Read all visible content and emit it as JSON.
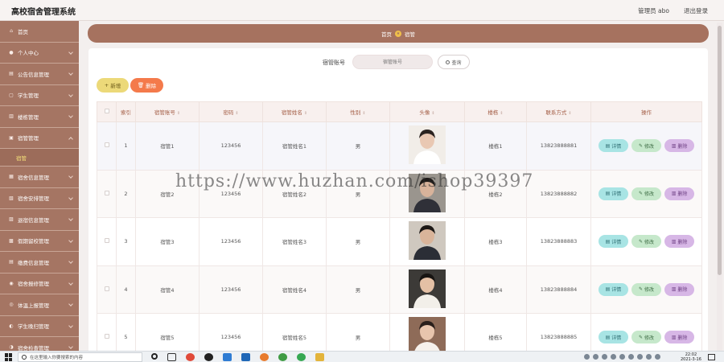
{
  "app": {
    "title": "高校宿舍管理系统",
    "user": "管理员 abo",
    "logout": "退出登录"
  },
  "sidebar": {
    "items": [
      {
        "label": "首页",
        "icon": "home-icon"
      },
      {
        "label": "个人中心",
        "icon": "user-icon"
      },
      {
        "label": "公告信息管理",
        "icon": "notice-icon"
      },
      {
        "label": "学生管理",
        "icon": "student-icon"
      },
      {
        "label": "楼栋管理",
        "icon": "building-icon"
      },
      {
        "label": "宿管管理",
        "icon": "manager-icon"
      }
    ],
    "active_sub": "宿管",
    "items_after": [
      {
        "label": "宿舍信息管理",
        "icon": "dorm-icon"
      },
      {
        "label": "宿舍安排管理",
        "icon": "arrange-icon"
      },
      {
        "label": "退宿信息管理",
        "icon": "checkout-icon"
      },
      {
        "label": "假期留校管理",
        "icon": "holiday-icon"
      },
      {
        "label": "缴费信息管理",
        "icon": "payment-icon"
      },
      {
        "label": "宿舍报修管理",
        "icon": "repair-icon"
      },
      {
        "label": "体温上报管理",
        "icon": "thermometer-icon"
      },
      {
        "label": "学生晚归管理",
        "icon": "late-icon"
      },
      {
        "label": "宿舍检查管理",
        "icon": "check-icon"
      }
    ]
  },
  "breadcrumb": {
    "home": "首页",
    "current": "宿管"
  },
  "search": {
    "label": "宿管账号",
    "placeholder": "宿管账号",
    "button": "查询"
  },
  "toolbar": {
    "add": "新增",
    "delete": "删除"
  },
  "table": {
    "headers": {
      "index": "索引",
      "account": "宿管账号",
      "password": "密码",
      "name": "宿管姓名",
      "gender": "性别",
      "avatar": "头像",
      "building": "楼栋",
      "phone": "联系方式",
      "actions": "操作"
    },
    "rows": [
      {
        "index": "1",
        "account": "宿管1",
        "password": "123456",
        "name": "宿管姓名1",
        "gender": "男",
        "building": "楼栋1",
        "phone": "13823888881"
      },
      {
        "index": "2",
        "account": "宿管2",
        "password": "123456",
        "name": "宿管姓名2",
        "gender": "男",
        "building": "楼栋2",
        "phone": "13823888882"
      },
      {
        "index": "3",
        "account": "宿管3",
        "password": "123456",
        "name": "宿管姓名3",
        "gender": "男",
        "building": "楼栋3",
        "phone": "13823888883"
      },
      {
        "index": "4",
        "account": "宿管4",
        "password": "123456",
        "name": "宿管姓名4",
        "gender": "男",
        "building": "楼栋4",
        "phone": "13823888884"
      },
      {
        "index": "5",
        "account": "宿管5",
        "password": "123456",
        "name": "宿管姓名5",
        "gender": "男",
        "building": "楼栋5",
        "phone": "13823888885"
      }
    ],
    "actions": {
      "detail": "详情",
      "edit": "修改",
      "delete": "删除"
    }
  },
  "watermark": "https://www.huzhan.com/ishop39397",
  "taskbar": {
    "search_placeholder": "在这里输入你要搜索的内容",
    "time": "22:02",
    "date": "2021-3-16"
  },
  "colors": {
    "sidebar": "#a57563",
    "accent": "#a6725f",
    "add": "#ecd979",
    "delete": "#f47a4b"
  }
}
